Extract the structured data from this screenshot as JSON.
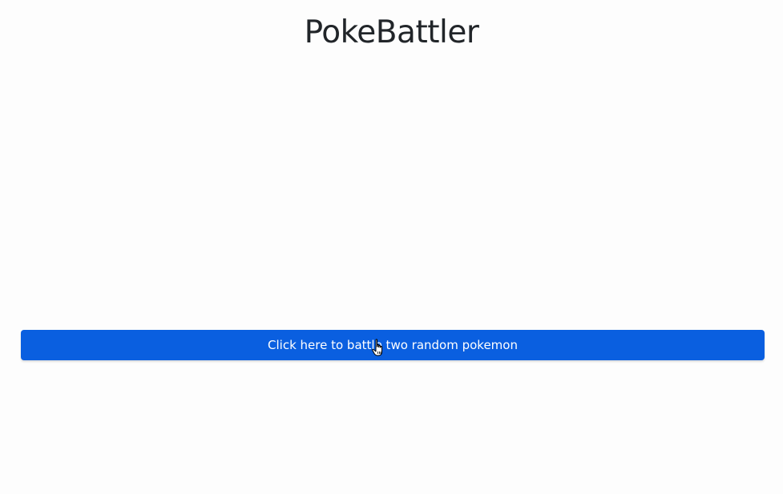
{
  "header": {
    "title": "PokeBattler"
  },
  "main": {
    "battle_button_label": "Click here to battle two random pokemon"
  },
  "colors": {
    "accent": "#0a5fe0",
    "background": "#fdfdfd",
    "title_text": "#212529"
  },
  "icons": {
    "cursor": "hand-pointer-icon"
  }
}
